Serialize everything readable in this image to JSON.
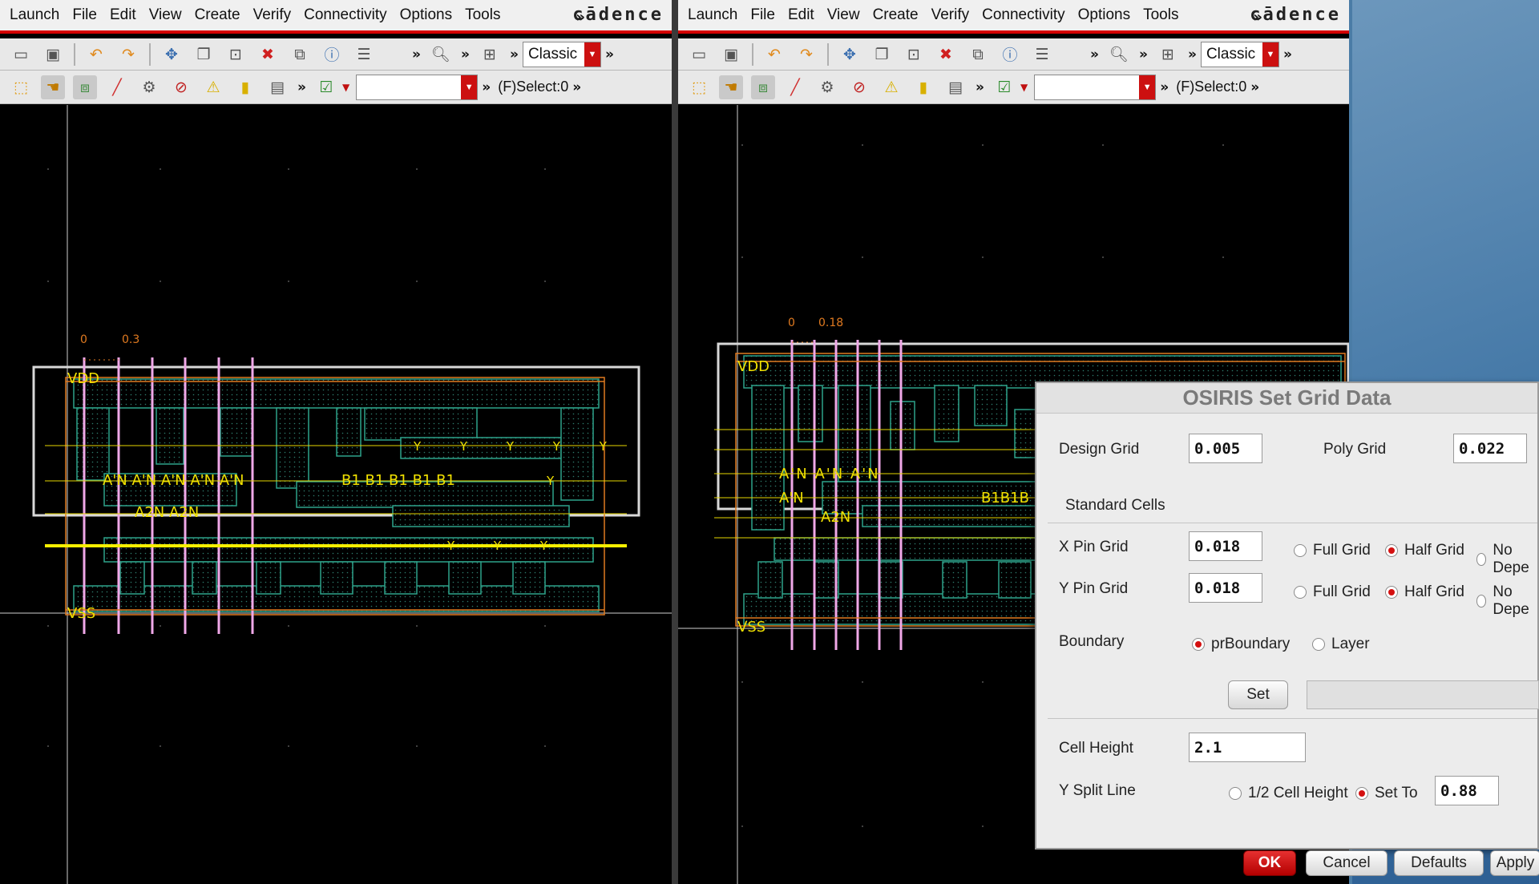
{
  "windows": {
    "left": {
      "menu": [
        "Launch",
        "File",
        "Edit",
        "View",
        "Create",
        "Verify",
        "Connectivity",
        "Options",
        "Tools"
      ],
      "logo": "cādence",
      "classic": "Classic",
      "select_info": "(F)Select:0",
      "ruler": {
        "a": "0",
        "b": "0.3"
      },
      "vdd": "VDD",
      "vss": "VSS",
      "pins": {
        "an": "A'N A'N A'N A'N A'N",
        "b1": "B1 B1 B1 B1 B1",
        "a2n": "A2N A2N",
        "y": "Y Y Y Y Y",
        "y2": "Y Y Y",
        "y3": "Y"
      }
    },
    "right": {
      "menu": [
        "Launch",
        "File",
        "Edit",
        "View",
        "Create",
        "Verify",
        "Connectivity",
        "Options",
        "Tools"
      ],
      "logo": "cādence",
      "classic": "Classic",
      "select_info": "(F)Select:0",
      "ruler": {
        "a": "0",
        "b": "0.18"
      },
      "vdd": "VDD",
      "vss": "VSS",
      "pins": {
        "an": "A'N A'N A'N",
        "an2": "A'N",
        "a2n": "A2N",
        "b1": "B1B1B"
      }
    }
  },
  "dialog": {
    "title": "OSIRIS Set Grid Data",
    "design_grid": {
      "label": "Design Grid",
      "value": "0.005"
    },
    "poly_grid": {
      "label": "Poly Grid",
      "value": "0.022"
    },
    "standard_cells": "Standard Cells",
    "x_pin_grid": {
      "label": "X Pin Grid",
      "value": "0.018"
    },
    "y_pin_grid": {
      "label": "Y Pin Grid",
      "value": "0.018"
    },
    "grid_options": {
      "full": "Full Grid",
      "half": "Half Grid",
      "none": "No Depe"
    },
    "boundary": {
      "label": "Boundary",
      "opt1": "prBoundary",
      "opt2": "Layer"
    },
    "set_button": "Set",
    "cell_height": {
      "label": "Cell Height",
      "value": "2.1"
    },
    "y_split": {
      "label": "Y Split Line",
      "opt1": "1/2 Cell Height",
      "opt2": "Set To",
      "value": "0.88"
    },
    "buttons": {
      "ok": "OK",
      "cancel": "Cancel",
      "defaults": "Defaults",
      "apply": "Apply"
    }
  }
}
